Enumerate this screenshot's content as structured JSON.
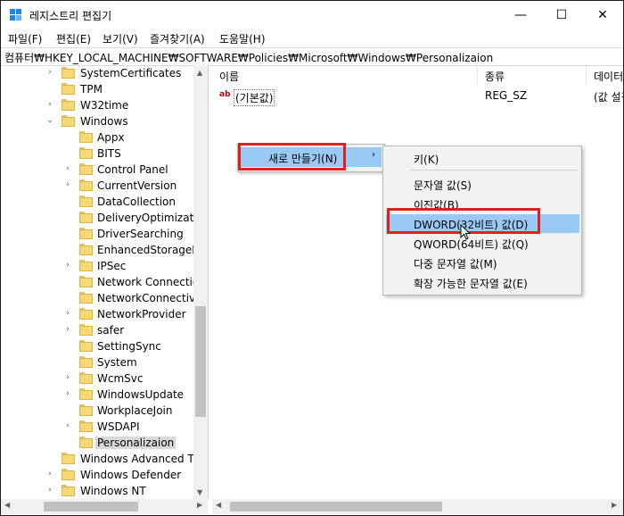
{
  "window": {
    "title": "레지스트리 편집기",
    "controls": {
      "minimize": "—",
      "maximize": "☐",
      "close": "✕"
    }
  },
  "menu": [
    "파일(F)",
    "편집(E)",
    "보기(V)",
    "즐겨찾기(A)",
    "도움말(H)"
  ],
  "address": "컴퓨터₩HKEY_LOCAL_MACHINE₩SOFTWARE₩Policies₩Microsoft₩Windows₩Personalizaion",
  "tree": {
    "items": [
      {
        "label": "SystemCertificates",
        "expander": "›"
      },
      {
        "label": "TPM",
        "expander": ""
      },
      {
        "label": "W32time",
        "expander": "›"
      },
      {
        "label": "Windows",
        "expander": "⌄"
      },
      {
        "label": "Appx",
        "expander": ""
      },
      {
        "label": "BITS",
        "expander": ""
      },
      {
        "label": "Control Panel",
        "expander": "›"
      },
      {
        "label": "CurrentVersion",
        "expander": "›"
      },
      {
        "label": "DataCollection",
        "expander": ""
      },
      {
        "label": "DeliveryOptimizatio",
        "expander": ""
      },
      {
        "label": "DriverSearching",
        "expander": ""
      },
      {
        "label": "EnhancedStorageDe",
        "expander": ""
      },
      {
        "label": "IPSec",
        "expander": "›"
      },
      {
        "label": "Network Connection",
        "expander": ""
      },
      {
        "label": "NetworkConnectivit",
        "expander": ""
      },
      {
        "label": "NetworkProvider",
        "expander": "›"
      },
      {
        "label": "safer",
        "expander": "›"
      },
      {
        "label": "SettingSync",
        "expander": ""
      },
      {
        "label": "System",
        "expander": ""
      },
      {
        "label": "WcmSvc",
        "expander": "›"
      },
      {
        "label": "WindowsUpdate",
        "expander": "›"
      },
      {
        "label": "WorkplaceJoin",
        "expander": ""
      },
      {
        "label": "WSDAPI",
        "expander": "›"
      },
      {
        "label": "Personalizaion",
        "expander": ""
      },
      {
        "label": "Windows Advanced Thr",
        "expander": ""
      },
      {
        "label": "Windows Defender",
        "expander": "›"
      },
      {
        "label": "Windows NT",
        "expander": "›"
      }
    ]
  },
  "list": {
    "columns": [
      "이름",
      "종류",
      "데이터"
    ],
    "rows": [
      {
        "name": "(기본값)",
        "type": "REG_SZ",
        "data": "(값 설정 안 됨)",
        "icon": "ab"
      }
    ]
  },
  "context_menu": {
    "new_label": "새로 만들기(N)",
    "submenu_arrow": "›"
  },
  "submenu": {
    "items": [
      "키(K)",
      "문자열 값(S)",
      "이진값(B)",
      "DWORD(32비트) 값(D)",
      "QWORD(64비트) 값(Q)",
      "다중 문자열 값(M)",
      "확장 가능한 문자열 값(E)"
    ]
  }
}
